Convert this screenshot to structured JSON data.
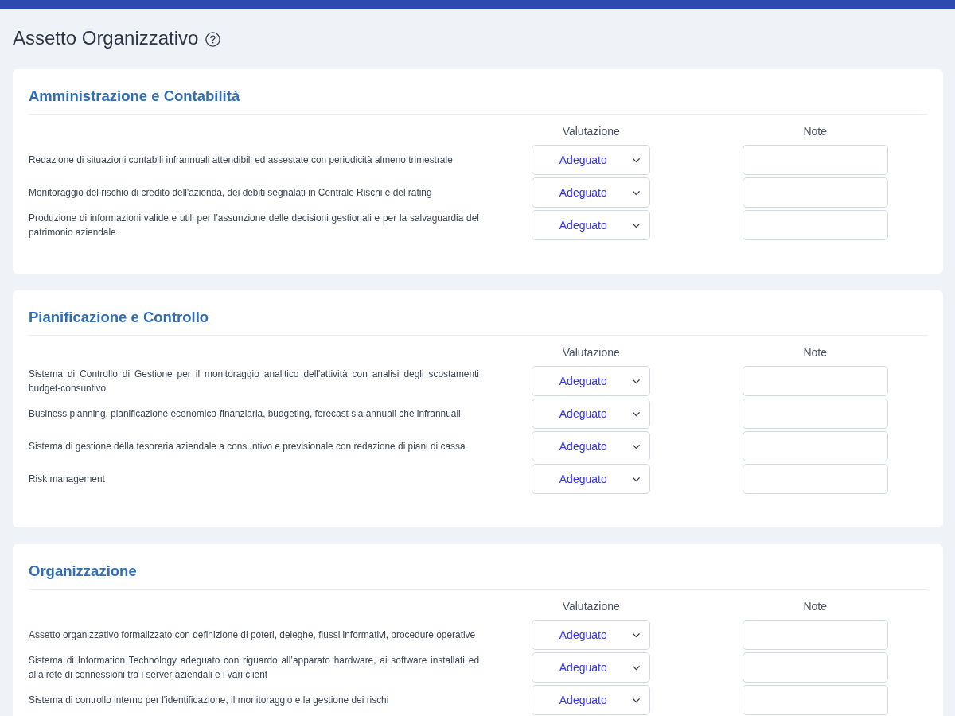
{
  "page": {
    "title": "Assetto Organizzativo"
  },
  "sections": [
    {
      "title": "Amministrazione e Contabilità",
      "column_headers": {
        "rating": "Valutazione",
        "note": "Note"
      },
      "rows": [
        {
          "label": "Redazione di situazioni contabili infrannuali attendibili ed assestate con periodicità almeno trimestrale",
          "rating": "Adeguato"
        },
        {
          "label": "Monitoraggio del rischio di credito dell'azienda, dei debiti segnalati in Centrale Rischi e del rating",
          "rating": "Adeguato"
        },
        {
          "label": "Produzione di informazioni valide e utili per l’assunzione delle decisioni gestionali e per la salvaguardia del patrimonio aziendale",
          "rating": "Adeguato"
        }
      ]
    },
    {
      "title": "Pianificazione e Controllo",
      "column_headers": {
        "rating": "Valutazione",
        "note": "Note"
      },
      "rows": [
        {
          "label": "Sistema di Controllo di Gestione per il monitoraggio analitico dell'attività con analisi degli scostamenti budget-consuntivo",
          "rating": "Adeguato"
        },
        {
          "label": "Business planning, pianificazione economico-finanziaria, budgeting, forecast sia annuali che infrannuali",
          "rating": "Adeguato"
        },
        {
          "label": "Sistema di gestione della tesoreria aziendale a consuntivo e previsionale con redazione di piani di cassa",
          "rating": "Adeguato"
        },
        {
          "label": "Risk management",
          "rating": "Adeguato"
        }
      ]
    },
    {
      "title": "Organizzazione",
      "column_headers": {
        "rating": "Valutazione",
        "note": "Note"
      },
      "rows": [
        {
          "label": "Assetto organizzativo formalizzato con definizione di poteri, deleghe, flussi informativi, procedure operative",
          "rating": "Adeguato"
        },
        {
          "label": "Sistema di Information Technology adeguato con riguardo all’apparato hardware, ai software installati ed alla rete di connessioni tra i server aziendali e i vari client",
          "rating": "Adeguato"
        },
        {
          "label": "Sistema di controllo interno per l'identificazione, il monitoraggio e la gestione dei rischi",
          "rating": "Adeguato"
        }
      ]
    }
  ]
}
